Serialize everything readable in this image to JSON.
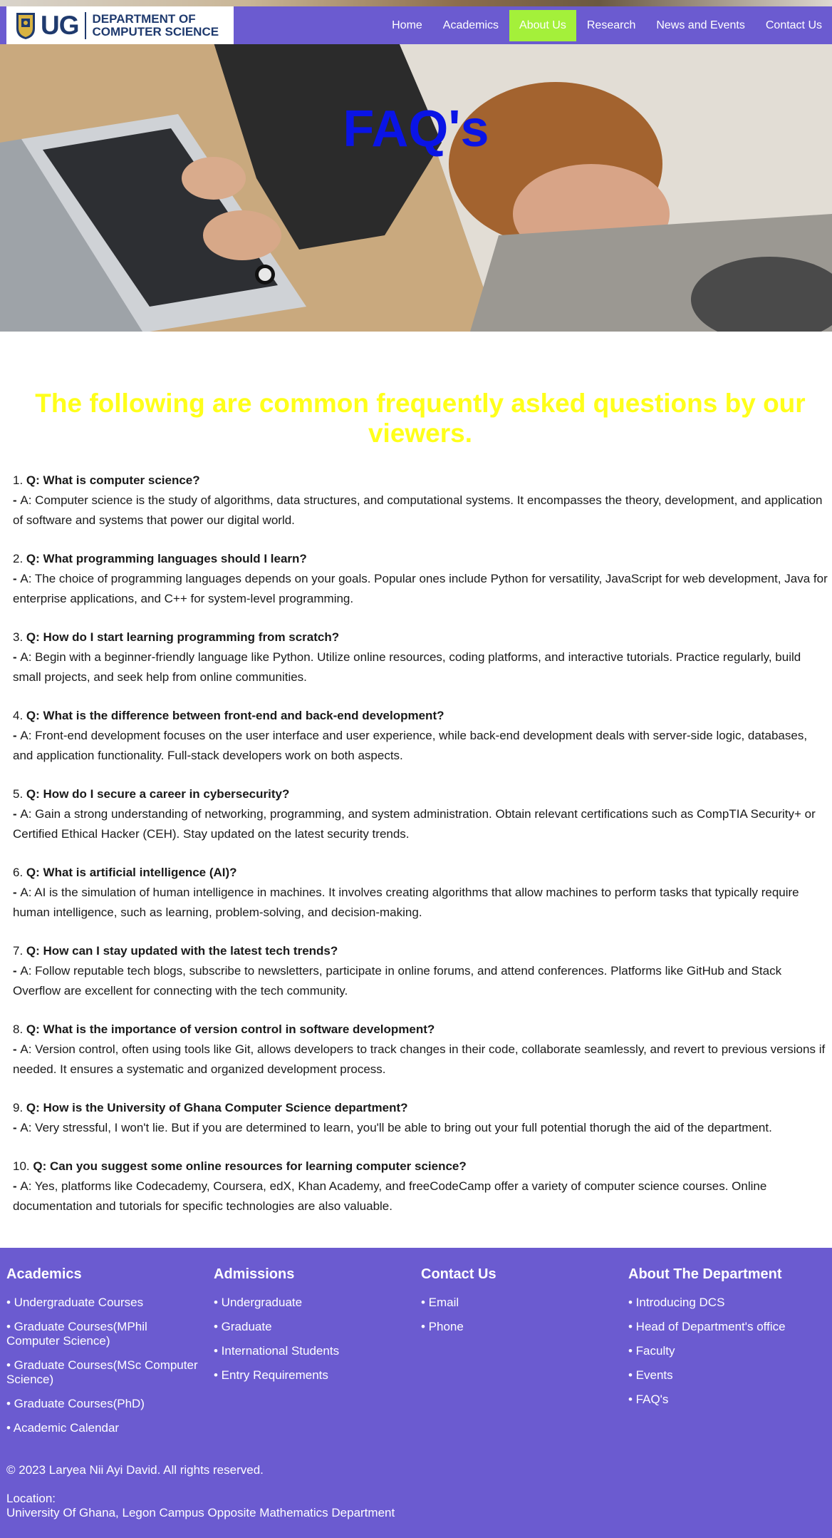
{
  "header": {
    "logo_text": "UG",
    "dept_line1": "DEPARTMENT OF",
    "dept_line2": "COMPUTER SCIENCE",
    "nav": [
      "Home",
      "Academics",
      "About Us",
      "Research",
      "News and Events",
      "Contact Us"
    ],
    "active_nav": "About Us",
    "nav_color": "#6b5bd0",
    "active_color": "#a4f03a"
  },
  "hero": {
    "title": "FAQ's",
    "title_color": "#0a14e6"
  },
  "intro": {
    "text": "The following are common frequently asked questions by our viewers.",
    "color": "#ffff1a"
  },
  "faqs": [
    {
      "num": "1.",
      "q": "Q: What is computer science?",
      "a": "A: Computer science is the study of algorithms, data structures, and computational systems. It encompasses the theory, development, and application of software and systems that power our digital world."
    },
    {
      "num": "2.",
      "q": "Q: What programming languages should I learn?",
      "a": "A: The choice of programming languages depends on your goals. Popular ones include Python for versatility, JavaScript for web development, Java for enterprise applications, and C++ for system-level programming."
    },
    {
      "num": "3.",
      "q": "Q: How do I start learning programming from scratch?",
      "a": "A: Begin with a beginner-friendly language like Python. Utilize online resources, coding platforms, and interactive tutorials. Practice regularly, build small projects, and seek help from online communities."
    },
    {
      "num": "4.",
      "q": "Q: What is the difference between front-end and back-end development?",
      "a": "A: Front-end development focuses on the user interface and user experience, while back-end development deals with server-side logic, databases, and application functionality. Full-stack developers work on both aspects."
    },
    {
      "num": "5.",
      "q": "Q: How do I secure a career in cybersecurity?",
      "a": "A: Gain a strong understanding of networking, programming, and system administration. Obtain relevant certifications such as CompTIA Security+ or Certified Ethical Hacker (CEH). Stay updated on the latest security trends."
    },
    {
      "num": "6.",
      "q": "Q: What is artificial intelligence (AI)?",
      "a": "A: AI is the simulation of human intelligence in machines. It involves creating algorithms that allow machines to perform tasks that typically require human intelligence, such as learning, problem-solving, and decision-making."
    },
    {
      "num": "7.",
      "q": "Q: How can I stay updated with the latest tech trends?",
      "a": "A: Follow reputable tech blogs, subscribe to newsletters, participate in online forums, and attend conferences. Platforms like GitHub and Stack Overflow are excellent for connecting with the tech community."
    },
    {
      "num": "8.",
      "q": "Q: What is the importance of version control in software development?",
      "a": "A: Version control, often using tools like Git, allows developers to track changes in their code, collaborate seamlessly, and revert to previous versions if needed. It ensures a systematic and organized development process."
    },
    {
      "num": "9.",
      "q": "Q: How is the University of Ghana Computer Science department?",
      "a": "A: Very stressful, I won't lie. But if you are determined to learn, you'll be able to bring out your full potential thorugh the aid of the department."
    },
    {
      "num": "10.",
      "q": "Q: Can you suggest some online resources for learning computer science?",
      "a": "A: Yes, platforms like Codecademy, Coursera, edX, Khan Academy, and freeCodeCamp offer a variety of computer science courses. Online documentation and tutorials for specific technologies are also valuable."
    }
  ],
  "footer": {
    "columns": [
      {
        "title": "Academics",
        "links": [
          "• Undergraduate Courses",
          "• Graduate Courses(MPhil Computer Science)",
          "• Graduate Courses(MSc Computer Science)",
          "• Graduate Courses(PhD)",
          "• Academic Calendar"
        ]
      },
      {
        "title": "Admissions",
        "links": [
          "• Undergraduate",
          "• Graduate",
          "• International Students",
          "• Entry Requirements"
        ]
      },
      {
        "title": "Contact Us",
        "links": [
          "• Email",
          "• Phone"
        ]
      },
      {
        "title": "About The Department",
        "links": [
          "• Introducing DCS",
          "• Head of Department's office",
          "• Faculty",
          "• Events",
          "• FAQ's"
        ]
      }
    ],
    "copyright": "© 2023 Laryea Nii Ayi David. All rights reserved.",
    "location_label": "Location:",
    "location": "University Of Ghana, Legon Campus Opposite Mathematics Department",
    "bg_color": "#6b5bd0"
  }
}
